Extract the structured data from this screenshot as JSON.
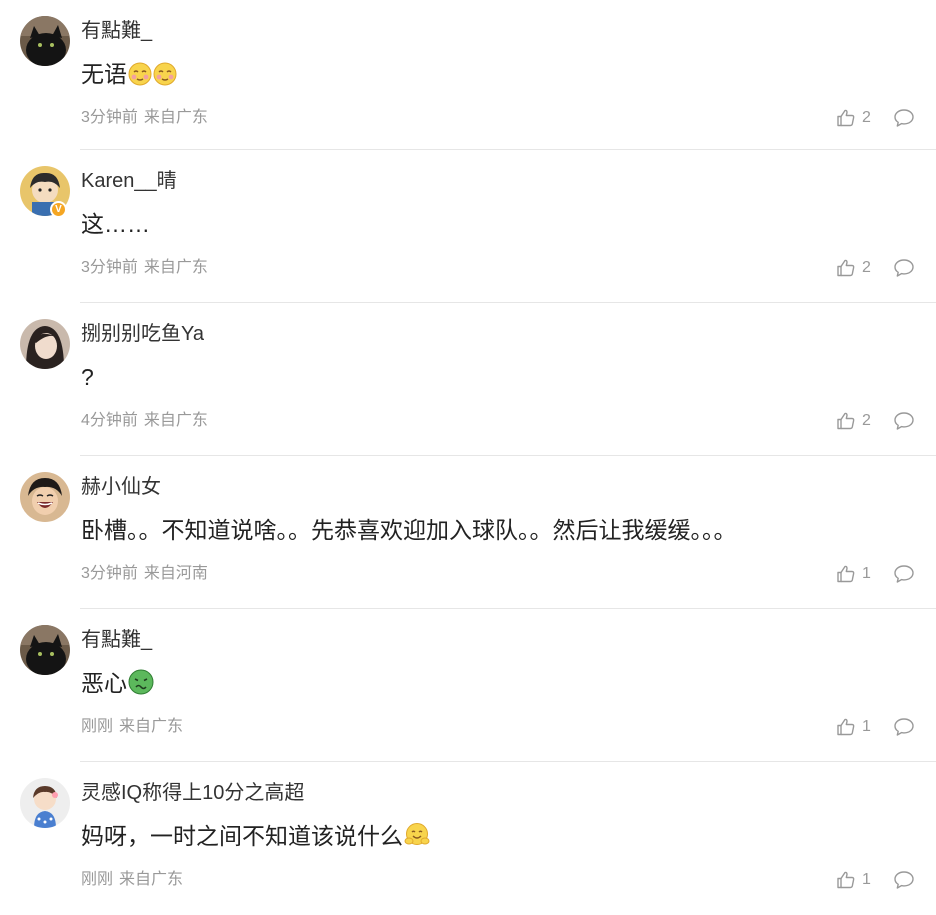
{
  "comments": [
    {
      "username": "有點難_",
      "content": "无语",
      "emojis": [
        "smirk-face",
        "smirk-face"
      ],
      "time": "3分钟前",
      "source": "来自广东",
      "likes": "2",
      "avatar": "black-cat",
      "verified": false
    },
    {
      "username": "Karen__晴",
      "content": "这……",
      "emojis": [],
      "time": "3分钟前",
      "source": "来自广东",
      "likes": "2",
      "avatar": "cartoon-person",
      "verified": true
    },
    {
      "username": "捌别别吃鱼Ya",
      "content": "?",
      "emojis": [],
      "time": "4分钟前",
      "source": "来自广东",
      "likes": "2",
      "avatar": "girl-portrait",
      "verified": false
    },
    {
      "username": "赫小仙女",
      "content": "卧槽。。不知道说啥。。先恭喜欢迎加入球队。。然后让我缓缓。。。",
      "emojis": [],
      "time": "3分钟前",
      "source": "来自河南",
      "likes": "1",
      "avatar": "laughing-person",
      "verified": false
    },
    {
      "username": "有點難_",
      "content": "恶心",
      "emojis": [
        "nauseated-face"
      ],
      "time": "刚刚",
      "source": "来自广东",
      "likes": "1",
      "avatar": "black-cat",
      "verified": false
    },
    {
      "username": "灵感IQ称得上10分之高超",
      "content": "妈呀，一时之间不知道该说什么",
      "emojis": [
        "hug-face"
      ],
      "time": "刚刚",
      "source": "来自广东",
      "likes": "1",
      "avatar": "cartoon-girl",
      "verified": false
    }
  ],
  "colors": {
    "text": "#333333",
    "meta": "#999999",
    "divider": "#e6e6e6",
    "verified_badge": "#f5a623"
  },
  "icons": {
    "like": "thumbs-up-icon",
    "reply": "comment-bubble-icon"
  }
}
